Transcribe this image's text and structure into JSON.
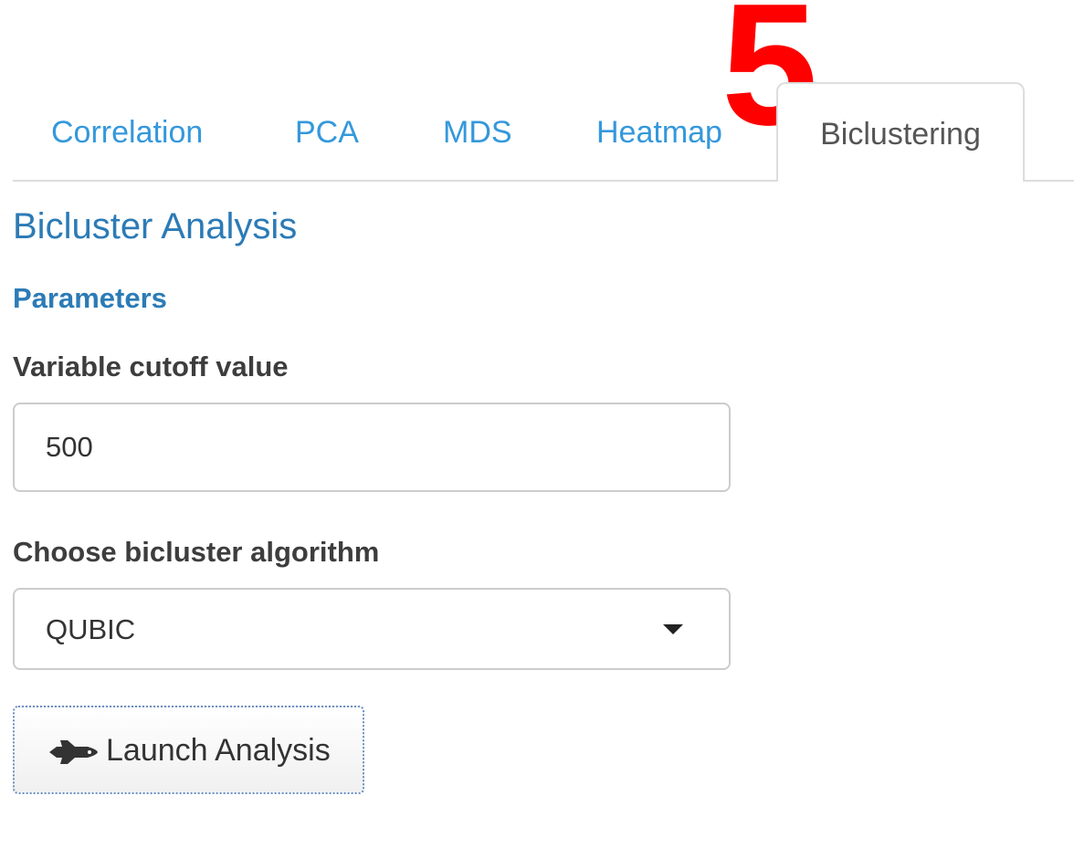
{
  "annotation": {
    "marker": "5"
  },
  "tabs": [
    {
      "label": "Correlation",
      "active": false
    },
    {
      "label": "PCA",
      "active": false
    },
    {
      "label": "MDS",
      "active": false
    },
    {
      "label": "Heatmap",
      "active": false
    },
    {
      "label": "Biclustering",
      "active": true
    }
  ],
  "main": {
    "title": "Bicluster Analysis",
    "section_title": "Parameters",
    "cutoff": {
      "label": "Variable cutoff value",
      "value": "500"
    },
    "algorithm": {
      "label": "Choose bicluster algorithm",
      "selected": "QUBIC"
    },
    "launch_button": {
      "label": "Launch Analysis",
      "icon": "space-shuttle-icon"
    }
  },
  "colors": {
    "link": "#3498db",
    "heading": "#2c7bb6",
    "annotation": "#ff0000"
  }
}
